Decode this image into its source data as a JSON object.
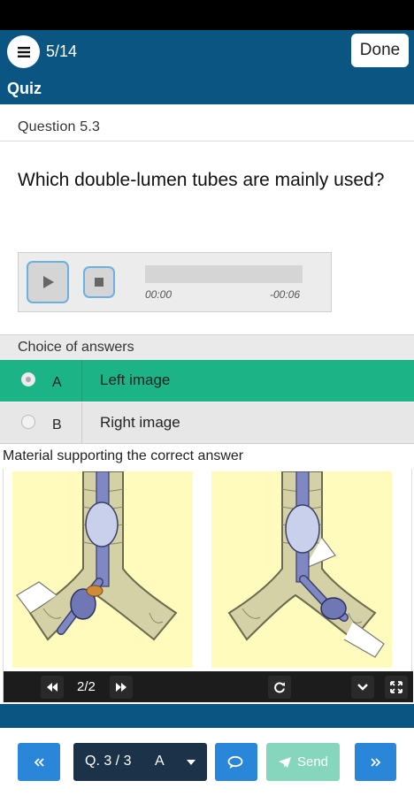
{
  "header": {
    "progress": "5/14",
    "done_label": "Done",
    "title": "Quiz"
  },
  "question": {
    "number": "Question 5.3",
    "text": "Which double-lumen tubes are mainly used?"
  },
  "audio": {
    "elapsed": "00:00",
    "remaining": "-00:06"
  },
  "answers": {
    "header": "Choice of answers",
    "items": [
      {
        "letter": "A",
        "label": "Left image",
        "selected": true
      },
      {
        "letter": "B",
        "label": "Right image",
        "selected": false
      }
    ]
  },
  "support": {
    "header": "Material supporting the correct answer",
    "page_indicator": "2/2"
  },
  "bottom_nav": {
    "question_label": "Q. 3 / 3",
    "question_answer": "A",
    "send_label": "Send"
  },
  "colors": {
    "appbar": "#0b5583",
    "selected_answer": "#1cb487",
    "nav_button": "#2a86d8",
    "send_button": "#86d6be",
    "select_bg": "#1b3249",
    "image_bg": "#fffbbd"
  }
}
